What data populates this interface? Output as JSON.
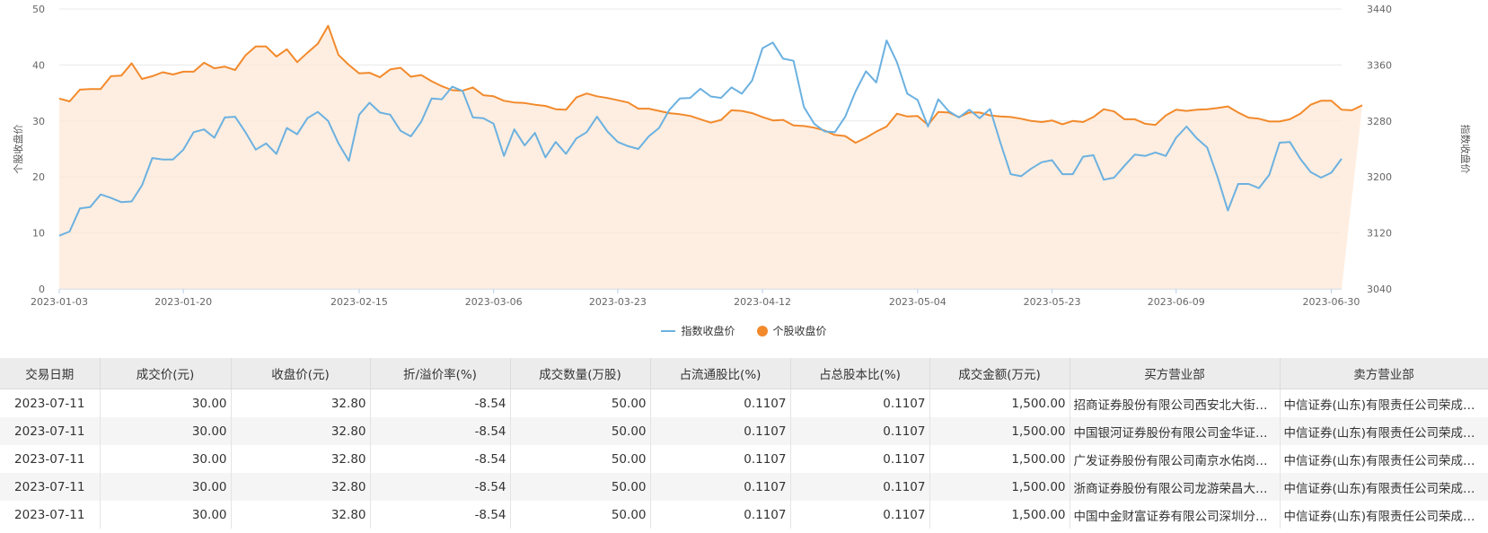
{
  "chart_data": {
    "type": "line",
    "x_ticks": [
      "2023-01-03",
      "2023-01-20",
      "2023-02-15",
      "2023-03-06",
      "2023-03-23",
      "2023-04-12",
      "2023-05-04",
      "2023-05-23",
      "2023-06-09",
      "2023-06-30"
    ],
    "y_left": {
      "label": "个股收盘价",
      "ylim": [
        0,
        50
      ],
      "ticks": [
        "0",
        "10",
        "20",
        "30",
        "40",
        "50"
      ]
    },
    "y_right": {
      "label": "指数收盘价",
      "ylim": [
        3040,
        3440
      ],
      "ticks": [
        "3040",
        "3120",
        "3200",
        "3280",
        "3360",
        "3440"
      ]
    },
    "grid": true,
    "legend_position": "bottom-center",
    "series": [
      {
        "name": "指数收盘价",
        "axis": "right",
        "color": "#6cb1e0",
        "values": [
          3116,
          3122,
          3155,
          3157,
          3175,
          3170,
          3164,
          3165,
          3188,
          3227,
          3225,
          3225,
          3239,
          3264,
          3268,
          3256,
          3285,
          3286,
          3264,
          3239,
          3248,
          3233,
          3270,
          3261,
          3284,
          3293,
          3280,
          3248,
          3223,
          3289,
          3306,
          3292,
          3289,
          3266,
          3258,
          3279,
          3312,
          3311,
          3329,
          3323,
          3285,
          3284,
          3276,
          3230,
          3268,
          3245,
          3263,
          3228,
          3250,
          3233,
          3255,
          3264,
          3286,
          3265,
          3250,
          3244,
          3240,
          3258,
          3270,
          3296,
          3312,
          3313,
          3326,
          3315,
          3313,
          3328,
          3319,
          3338,
          3384,
          3392,
          3369,
          3366,
          3300,
          3276,
          3265,
          3264,
          3286,
          3322,
          3351,
          3335,
          3395,
          3364,
          3319,
          3310,
          3272,
          3311,
          3294,
          3285,
          3296,
          3284,
          3297,
          3249,
          3204,
          3201,
          3212,
          3221,
          3224,
          3204,
          3204,
          3229,
          3231,
          3196,
          3199,
          3216,
          3232,
          3230,
          3235,
          3230,
          3256,
          3272,
          3255,
          3242,
          3200,
          3152,
          3190,
          3190,
          3184,
          3203,
          3249,
          3250,
          3226,
          3207,
          3199,
          3206,
          3226
        ]
      },
      {
        "name": "个股收盘价",
        "axis": "left",
        "color": "#f28a2c",
        "values": [
          34.0,
          33.5,
          35.6,
          35.7,
          35.7,
          38.0,
          38.1,
          40.3,
          37.5,
          38.0,
          38.7,
          38.3,
          38.8,
          38.8,
          40.4,
          39.4,
          39.7,
          39.1,
          41.7,
          43.3,
          43.3,
          41.5,
          42.8,
          40.5,
          42.2,
          43.8,
          47.0,
          41.8,
          40.0,
          38.5,
          38.6,
          37.8,
          39.2,
          39.5,
          37.9,
          38.2,
          37.1,
          36.2,
          35.5,
          35.4,
          36.0,
          34.6,
          34.4,
          33.6,
          33.3,
          33.2,
          32.9,
          32.7,
          32.1,
          32.0,
          34.2,
          34.9,
          34.4,
          34.1,
          33.7,
          33.3,
          32.2,
          32.2,
          31.8,
          31.4,
          31.2,
          30.9,
          30.3,
          29.7,
          30.2,
          31.9,
          31.8,
          31.4,
          30.7,
          30.1,
          30.2,
          29.2,
          29.1,
          28.8,
          28.3,
          27.5,
          27.3,
          26.1,
          27.0,
          28.1,
          29.0,
          31.3,
          30.8,
          30.9,
          29.3,
          31.6,
          31.5,
          30.7,
          31.5,
          31.5,
          31.0,
          30.8,
          30.7,
          30.4,
          30.0,
          29.8,
          30.1,
          29.4,
          30.0,
          29.8,
          30.7,
          32.1,
          31.7,
          30.3,
          30.3,
          29.5,
          29.3,
          31.0,
          32.0,
          31.8,
          32.0,
          32.1,
          32.3,
          32.6,
          31.5,
          30.6,
          30.4,
          29.9,
          29.9,
          30.3,
          31.3,
          32.9,
          33.6,
          33.6,
          32.0,
          31.9,
          32.8
        ]
      }
    ]
  },
  "table": {
    "headers": [
      "交易日期",
      "成交价(元)",
      "收盘价(元)",
      "折/溢价率(%)",
      "成交数量(万股)",
      "占流通股比(%)",
      "占总股本比(%)",
      "成交金额(万元)",
      "买方营业部",
      "卖方营业部"
    ],
    "rows": [
      [
        "2023-07-11",
        "30.00",
        "32.80",
        "-8.54",
        "50.00",
        "0.1107",
        "0.1107",
        "1,500.00",
        "招商证券股份有限公司西安北大街证券营业部",
        "中信证券(山东)有限责任公司荣成成山大道证券营业部"
      ],
      [
        "2023-07-11",
        "30.00",
        "32.80",
        "-8.54",
        "50.00",
        "0.1107",
        "0.1107",
        "1,500.00",
        "中国银河证券股份有限公司金华证券营业部",
        "中信证券(山东)有限责任公司荣成成山大道证券营业部"
      ],
      [
        "2023-07-11",
        "30.00",
        "32.80",
        "-8.54",
        "50.00",
        "0.1107",
        "0.1107",
        "1,500.00",
        "广发证券股份有限公司南京水佑岗证券营业部",
        "中信证券(山东)有限责任公司荣成成山大道证券营业部"
      ],
      [
        "2023-07-11",
        "30.00",
        "32.80",
        "-8.54",
        "50.00",
        "0.1107",
        "0.1107",
        "1,500.00",
        "浙商证券股份有限公司龙游荣昌大道证券营业部",
        "中信证券(山东)有限责任公司荣成成山大道证券营业部"
      ],
      [
        "2023-07-11",
        "30.00",
        "32.80",
        "-8.54",
        "50.00",
        "0.1107",
        "0.1107",
        "1,500.00",
        "中国中金财富证券有限公司深圳分公司",
        "中信证券(山东)有限责任公司荣成成山大道证券营业部"
      ]
    ]
  }
}
